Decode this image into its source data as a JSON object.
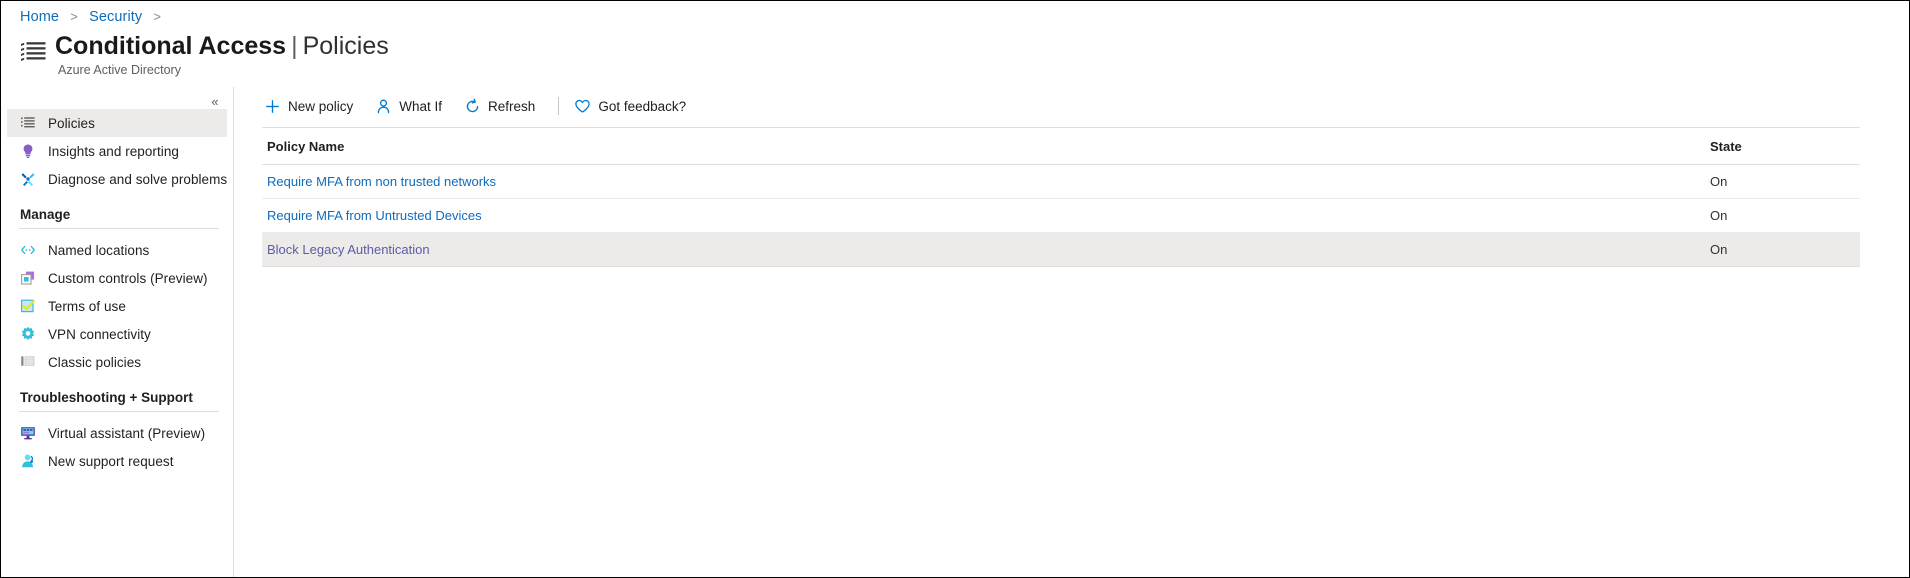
{
  "breadcrumb": {
    "items": [
      "Home",
      "Security"
    ],
    "separator": ">"
  },
  "header": {
    "icon": "policy-list-icon",
    "title": "Conditional Access",
    "separator": "|",
    "subtitle_inline": "Policies",
    "service": "Azure Active Directory"
  },
  "sidebar": {
    "collapse_label": "«",
    "top_items": [
      {
        "label": "Policies",
        "icon": "list-icon",
        "selected": true
      },
      {
        "label": "Insights and reporting",
        "icon": "lightbulb-icon",
        "selected": false
      },
      {
        "label": "Diagnose and solve problems",
        "icon": "wrench-icon",
        "selected": false
      }
    ],
    "groups": [
      {
        "label": "Manage",
        "items": [
          {
            "label": "Named locations",
            "icon": "code-brackets-icon"
          },
          {
            "label": "Custom controls (Preview)",
            "icon": "custom-control-icon"
          },
          {
            "label": "Terms of use",
            "icon": "checkbox-icon"
          },
          {
            "label": "VPN connectivity",
            "icon": "gear-icon"
          },
          {
            "label": "Classic policies",
            "icon": "classic-list-icon"
          }
        ]
      },
      {
        "label": "Troubleshooting + Support",
        "items": [
          {
            "label": "Virtual assistant (Preview)",
            "icon": "monitor-assistant-icon"
          },
          {
            "label": "New support request",
            "icon": "support-person-icon"
          }
        ]
      }
    ]
  },
  "toolbar": {
    "commands": [
      {
        "label": "New policy",
        "icon": "plus-icon"
      },
      {
        "label": "What If",
        "icon": "person-icon"
      },
      {
        "label": "Refresh",
        "icon": "refresh-icon"
      }
    ],
    "feedback": {
      "label": "Got feedback?",
      "icon": "heart-icon"
    }
  },
  "table": {
    "columns": [
      "Policy Name",
      "State"
    ],
    "rows": [
      {
        "name": "Require MFA from non trusted networks",
        "state": "On",
        "visited": false,
        "highlighted": false
      },
      {
        "name": "Require MFA from Untrusted Devices",
        "state": "On",
        "visited": false,
        "highlighted": false
      },
      {
        "name": "Block Legacy Authentication",
        "state": "On",
        "visited": true,
        "highlighted": true
      }
    ]
  },
  "colors": {
    "accent": "#0078d4",
    "link": "#0f6cbd",
    "visited_link": "#5c5ca8",
    "row_highlight": "#edebe9",
    "text": "#201f1e",
    "muted": "#605e5c"
  }
}
